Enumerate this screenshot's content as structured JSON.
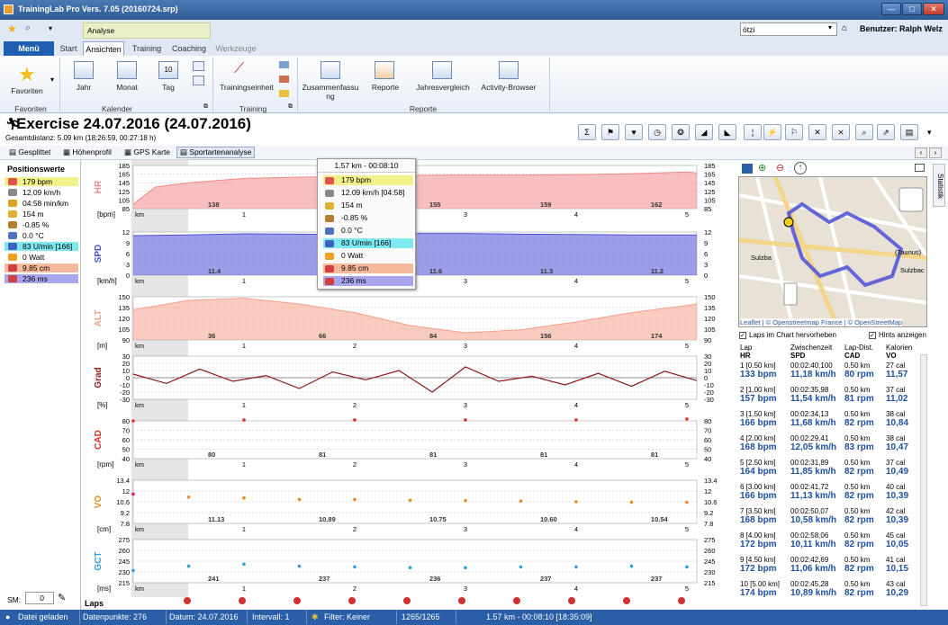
{
  "window": {
    "title": "TrainingLab Pro Vers. 7.05 (20160724.srp)",
    "min": "—",
    "max": "□",
    "close": "✕"
  },
  "qat": {
    "context_tab": "Analyse",
    "user_combo": "ötzi",
    "user_label": "Benutzer: Ralph Welz"
  },
  "tabs": {
    "menu": "Menü",
    "start": "Start",
    "ansichten": "Ansichten",
    "training": "Training",
    "coaching": "Coaching",
    "werkzeuge": "Werkzeuge"
  },
  "ribbon": {
    "favoriten": "Favoriten",
    "grp_favoriten": "Favoriten",
    "jahr": "Jahr",
    "monat": "Monat",
    "tag": "Tag",
    "tag_num": "10",
    "grp_kalender": "Kalender",
    "trainingseinheit": "Trainingseinheit",
    "grp_training": "Training",
    "zusammenfassung": "Zusammenfassu\nng",
    "reporte": "Reporte",
    "jahresvergleich": "Jahresvergleich",
    "activity_browser": "Activity-Browser",
    "grp_reporte": "Reporte"
  },
  "header": {
    "title": "Exercise 24.07.2016 (24.07.2016)",
    "subtitle": "Gesamtdistanz: 5.09 km (18:26:59, 00:27:18 h)"
  },
  "subtabs": [
    "Gesplittet",
    "Höhenprofil",
    "GPS Karte",
    "Sportartenanalyse"
  ],
  "positions": {
    "title": "Positionswerte",
    "items": [
      {
        "text": "179 bpm",
        "color": "#f3f28a"
      },
      {
        "text": "12.09 km/h",
        "color": ""
      },
      {
        "text": "04:58 min/km",
        "color": ""
      },
      {
        "text": "154 m",
        "color": ""
      },
      {
        "text": "-0.85 %",
        "color": ""
      },
      {
        "text": "0.0 °C",
        "color": ""
      },
      {
        "text": "83 U/min [166]",
        "color": "#7fe9f2"
      },
      {
        "text": "0 Watt",
        "color": ""
      },
      {
        "text": "9.85 cm",
        "color": "#f7b99c"
      },
      {
        "text": "236 ms",
        "color": "#a9a6f0"
      }
    ],
    "sm_label": "SM:",
    "sm_value": "0"
  },
  "tooltip": {
    "title": "1.57 km - 00:08:10",
    "items": [
      "179 bpm",
      "12.09 km/h [04:58]",
      "154 m",
      "-0.85 %",
      "0.0 °C",
      "83 U/min [166]",
      "0 Watt",
      "9.85 cm",
      "236 ms"
    ]
  },
  "chart_data": [
    {
      "type": "area",
      "title": "HR",
      "ylabel": "[bpm]",
      "xlabel": "km",
      "yticks": [
        85,
        105,
        125,
        145,
        165,
        185
      ],
      "ylim": [
        85,
        185
      ],
      "x": [
        0,
        0.2,
        0.5,
        1,
        1.5,
        2,
        2.5,
        3,
        3.5,
        4,
        4.5,
        5,
        5.09
      ],
      "y": [
        95,
        135,
        145,
        155,
        158,
        160,
        162,
        163,
        163,
        164,
        166,
        170,
        168
      ],
      "lap_labels": [
        "138",
        "155",
        "159",
        "162"
      ],
      "lap_label_x": [
        1,
        3,
        4,
        5
      ]
    },
    {
      "type": "area",
      "title": "SPD",
      "ylabel": "[km/h]",
      "xlabel": "km",
      "yticks": [
        0,
        3,
        6,
        9,
        12
      ],
      "ylim": [
        0,
        12
      ],
      "x": [
        0,
        0.5,
        1,
        1.5,
        2,
        2.5,
        3,
        3.5,
        4,
        4.5,
        5,
        5.09
      ],
      "y": [
        11,
        11.2,
        11.5,
        11.4,
        11.3,
        11.6,
        11.6,
        11.4,
        11.3,
        11.2,
        11.2,
        11.2
      ],
      "lap_labels": [
        "11.4",
        "11.6",
        "11.3",
        "11.2"
      ],
      "lap_label_x": [
        1,
        3,
        4,
        5
      ]
    },
    {
      "type": "area",
      "title": "ALT",
      "ylabel": "[m]",
      "xlabel": "km",
      "yticks": [
        90,
        105,
        120,
        135,
        150
      ],
      "ylim": [
        90,
        150
      ],
      "x": [
        0,
        0.5,
        1,
        1.5,
        2,
        2.5,
        3,
        3.5,
        4,
        4.5,
        5,
        5.09
      ],
      "y": [
        132,
        145,
        148,
        140,
        128,
        110,
        100,
        104,
        115,
        128,
        138,
        140
      ],
      "lap_labels": [
        "36",
        "66",
        "84",
        "156",
        "174"
      ],
      "lap_label_x": [
        1,
        2,
        3,
        4,
        5
      ]
    },
    {
      "type": "line",
      "title": "Grad",
      "ylabel": "[%]",
      "xlabel": "km",
      "yticks": [
        -30,
        -20,
        -10,
        0,
        10,
        20,
        30
      ],
      "ylim": [
        -30,
        30
      ],
      "x": [
        0,
        0.3,
        0.6,
        0.9,
        1.2,
        1.5,
        1.8,
        2.1,
        2.4,
        2.7,
        3,
        3.3,
        3.6,
        3.9,
        4.2,
        4.5,
        4.8,
        5.09
      ],
      "y": [
        5,
        -8,
        12,
        -5,
        3,
        -15,
        8,
        -3,
        10,
        -20,
        15,
        -5,
        2,
        -10,
        6,
        -12,
        9,
        -4
      ]
    },
    {
      "type": "scatter",
      "title": "CAD",
      "ylabel": "[rpm]",
      "xlabel": "km",
      "yticks": [
        40,
        50,
        60,
        70,
        80
      ],
      "ylim": [
        40,
        80
      ],
      "x": [
        0,
        1,
        2,
        3,
        4,
        5
      ],
      "y": [
        80,
        81,
        81,
        81,
        81,
        82
      ],
      "lap_labels": [
        "80",
        "81",
        "81",
        "81",
        "81"
      ],
      "lap_label_x": [
        1,
        2,
        3,
        4,
        5
      ]
    },
    {
      "type": "scatter",
      "title": "VO",
      "ylabel": "[cm]",
      "xlabel": "km",
      "yticks": [
        7.8,
        9.2,
        10.6,
        12.0,
        13.4
      ],
      "ylim": [
        7.8,
        13.4
      ],
      "x": [
        0,
        0.5,
        1,
        1.5,
        2,
        2.5,
        3,
        3.5,
        4,
        4.5,
        5
      ],
      "y": [
        11.6,
        11.2,
        11.1,
        10.9,
        10.9,
        10.8,
        10.75,
        10.7,
        10.6,
        10.55,
        10.54
      ],
      "lap_labels": [
        "11.13",
        "10.89",
        "10.75",
        "10.60",
        "10.54"
      ],
      "lap_label_x": [
        1,
        2,
        3,
        4,
        5
      ]
    },
    {
      "type": "scatter",
      "title": "GCT",
      "ylabel": "[ms]",
      "xlabel": "km",
      "yticks": [
        215,
        230,
        245,
        260,
        275
      ],
      "ylim": [
        215,
        275
      ],
      "x": [
        0,
        0.5,
        1,
        1.5,
        2,
        2.5,
        3,
        3.5,
        4,
        4.5,
        5
      ],
      "y": [
        232,
        238,
        241,
        238,
        237,
        236,
        236,
        237,
        237,
        238,
        237
      ],
      "lap_labels": [
        "241",
        "237",
        "236",
        "237",
        "237"
      ],
      "lap_label_x": [
        1,
        2,
        3,
        4,
        5
      ]
    }
  ],
  "laps_label": "Laps",
  "map": {
    "attrib": "Leaflet | © Openstreetmap France | © OpenStreetMap",
    "town_a": "Sulzba",
    "town_b": "(Taunus)",
    "town_c": "Sulzbac"
  },
  "right_checks": {
    "laps": "Laps im Chart hervorheben",
    "hints": "Hints anzeigen"
  },
  "statistik": "Statistik",
  "lap_header": {
    "c1a": "Lap",
    "c1b": "HR",
    "c2a": "Zwischenzeit",
    "c2b": "SPD",
    "c3a": "Lap-Dist.",
    "c3b": "CAD",
    "c4a": "Kalorien",
    "c4b": "VO"
  },
  "laps": [
    {
      "n": "1 [0.50 km]",
      "hr": "133 bpm",
      "t": "00:02:40,100",
      "spd": "11,18 km/h",
      "d": "0.50 km",
      "cad": "80 rpm",
      "kal": "27 cal",
      "vo": "11,57"
    },
    {
      "n": "2 [1.00 km]",
      "hr": "157 bpm",
      "t": "00:02:35,98",
      "spd": "11,54 km/h",
      "d": "0.50 km",
      "cad": "81 rpm",
      "kal": "37 cal",
      "vo": "11,02"
    },
    {
      "n": "3 [1.50 km]",
      "hr": "166 bpm",
      "t": "00:02:34,13",
      "spd": "11,68 km/h",
      "d": "0.50 km",
      "cad": "82 rpm",
      "kal": "38 cal",
      "vo": "10,84"
    },
    {
      "n": "4 [2.00 km]",
      "hr": "168 bpm",
      "t": "00:02:29,41",
      "spd": "12,05 km/h",
      "d": "0.50 km",
      "cad": "83 rpm",
      "kal": "38 cal",
      "vo": "10,47"
    },
    {
      "n": "5 [2.50 km]",
      "hr": "164 bpm",
      "t": "00:02:31,89",
      "spd": "11,85 km/h",
      "d": "0.50 km",
      "cad": "82 rpm",
      "kal": "37 cal",
      "vo": "10,49"
    },
    {
      "n": "6 [3.00 km]",
      "hr": "166 bpm",
      "t": "00:02:41,72",
      "spd": "11,13 km/h",
      "d": "0.50 km",
      "cad": "82 rpm",
      "kal": "40 cal",
      "vo": "10,39"
    },
    {
      "n": "7 [3.50 km]",
      "hr": "168 bpm",
      "t": "00:02:50,07",
      "spd": "10,58 km/h",
      "d": "0.50 km",
      "cad": "82 rpm",
      "kal": "42 cal",
      "vo": "10,39"
    },
    {
      "n": "8 [4.00 km]",
      "hr": "172 bpm",
      "t": "00:02:58,06",
      "spd": "10,11 km/h",
      "d": "0.50 km",
      "cad": "82 rpm",
      "kal": "45 cal",
      "vo": "10,05"
    },
    {
      "n": "9 [4.50 km]",
      "hr": "172 bpm",
      "t": "00:02:42,69",
      "spd": "11,06 km/h",
      "d": "0.50 km",
      "cad": "82 rpm",
      "kal": "41 cal",
      "vo": "10,15"
    },
    {
      "n": "10 [5.00 km]",
      "hr": "174 bpm",
      "t": "00:02:45,28",
      "spd": "10,89 km/h",
      "d": "0.50 km",
      "cad": "82 rpm",
      "kal": "43 cal",
      "vo": "10,29"
    }
  ],
  "status": {
    "loaded": "Datei geladen",
    "points": "Datenpunkte: 276",
    "date": "Datum: 24.07.2016",
    "interval": "Intervall: 1",
    "filter": "Filter: Keiner",
    "count": "1265/1265",
    "pos": "1.57 km - 00:08:10 [18:35:09]"
  },
  "colors": {
    "hr": "#f08a8a",
    "spd": "#4a4fd8",
    "alt": "#f5a08a",
    "grad": "#8b1a1a",
    "cad": "#e0302a",
    "vo_red": "#e02040",
    "vo_orange": "#e88a20",
    "gct": "#2aa0e0"
  }
}
